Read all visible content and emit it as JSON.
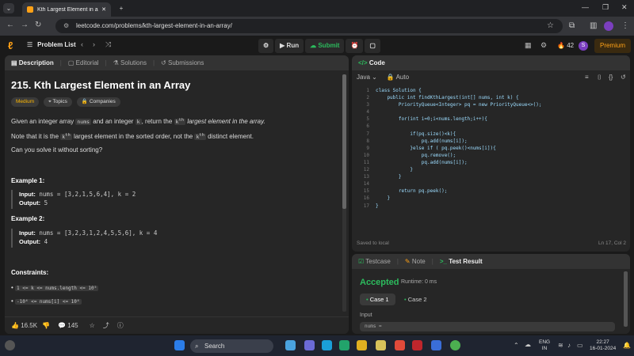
{
  "browser": {
    "tab_title": "Kth Largest Element in an Array",
    "url": "leetcode.com/problems/kth-largest-element-in-an-array/"
  },
  "header": {
    "problem_list": "Problem List",
    "run": "Run",
    "submit": "Submit",
    "streak": "42",
    "avatar_initial": "S",
    "premium": "Premium"
  },
  "left_tabs": [
    "Description",
    "Editorial",
    "Solutions",
    "Submissions"
  ],
  "problem": {
    "title": "215. Kth Largest Element in an Array",
    "difficulty": "Medium",
    "topics": "Topics",
    "companies": "Companies",
    "p1a": "Given an integer array",
    "p1_code1": "nums",
    "p1b": "and an integer",
    "p1_code2": "k",
    "p1c": ", return the",
    "p1_code3": "k",
    "p1_sup": "th",
    "p1d": "largest element in the array.",
    "p2a": "Note that it is the",
    "p2_sup": "th",
    "p2b": "largest element in the sorted order, not the",
    "p2c": "distinct element.",
    "p3": "Can you solve it without sorting?",
    "ex1_title": "Example 1:",
    "ex1_input_label": "Input:",
    "ex1_input": "nums = [3,2,1,5,6,4], k = 2",
    "ex1_output_label": "Output:",
    "ex1_output": "5",
    "ex2_title": "Example 2:",
    "ex2_input_label": "Input:",
    "ex2_input": "nums = [3,2,3,1,2,4,5,5,6], k = 4",
    "ex2_output_label": "Output:",
    "ex2_output": "4",
    "constraints_title": "Constraints:",
    "c1": "1 <= k <= nums.length <= 10⁵",
    "c2": "-10⁴ <= nums[i] <= 10⁴"
  },
  "left_footer": {
    "likes": "16.5K",
    "comments": "145"
  },
  "code_panel": {
    "title": "Code",
    "language": "Java",
    "mode": "Auto",
    "lines": [
      "class Solution {",
      "    public int findKthLargest(int[] nums, int k) {",
      "        PriorityQueue<Integer> pq = new PriorityQueue<>();",
      "",
      "        for(int i=0;i<nums.length;i++){",
      "",
      "            if(pq.size()<k){",
      "                pq.add(nums[i]);",
      "            }else if ( pq.peek()<nums[i]){",
      "                pq.remove();",
      "                pq.add(nums[i]);",
      "            }",
      "        }",
      "",
      "        return pq.peek();",
      "    }",
      "}"
    ],
    "saved": "Saved to local",
    "position": "Ln 17, Col 2"
  },
  "test_panel": {
    "tabs": [
      "Testcase",
      "Note",
      "Test Result"
    ],
    "status": "Accepted",
    "runtime": "Runtime: 0 ms",
    "case1": "Case 1",
    "case2": "Case 2",
    "input_label": "Input",
    "input_value": "nums ="
  },
  "taskbar": {
    "search": "Search",
    "lang": "ENG",
    "region": "IN",
    "time": "22:27",
    "date": "16-01-2024"
  },
  "colors": {
    "accent": "#ffa116",
    "success": "#2cbb5d",
    "medium": "#ffb800"
  }
}
